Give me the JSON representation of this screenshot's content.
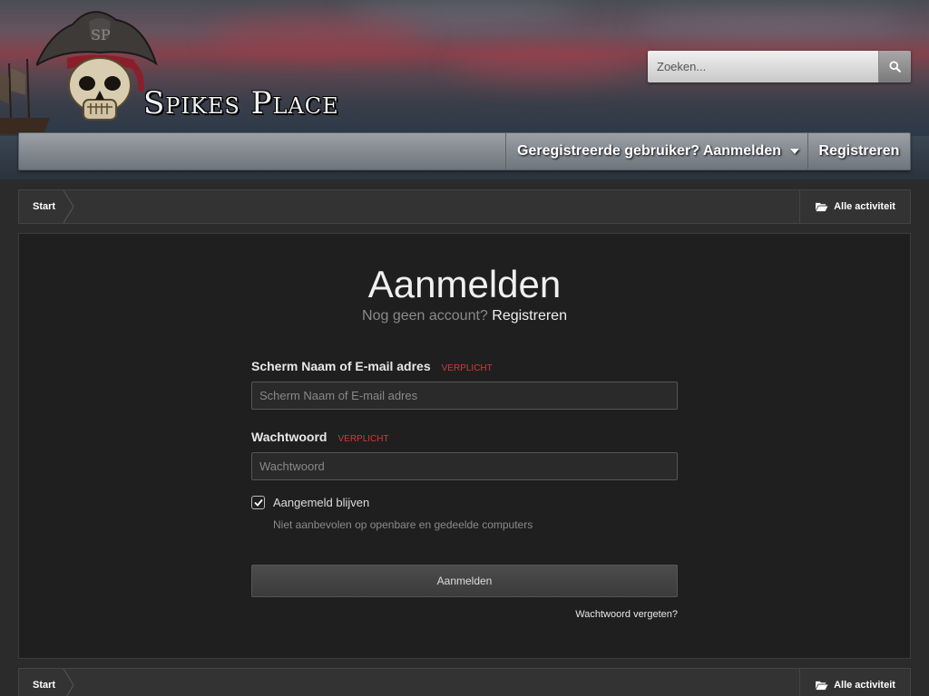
{
  "header": {
    "logo_text": "Spikes Place",
    "search": {
      "placeholder": "Zoeken..."
    }
  },
  "nav": {
    "user_menu_label": "Geregistreerde gebruiker? Aanmelden",
    "register_label": "Registreren"
  },
  "breadcrumb": {
    "start_label": "Start",
    "activity_label": "Alle activiteit"
  },
  "login": {
    "title": "Aanmelden",
    "no_account_text": "Nog geen account?",
    "register_link": "Registreren",
    "username": {
      "label": "Scherm Naam of E-mail adres",
      "required": "VERPLICHT",
      "placeholder": "Scherm Naam of E-mail adres",
      "value": ""
    },
    "password": {
      "label": "Wachtwoord",
      "required": "VERPLICHT",
      "placeholder": "Wachtwoord",
      "value": ""
    },
    "remember": {
      "label": "Aangemeld blijven",
      "description": "Niet aanbevolen op openbare en gedeelde computers",
      "checked": true
    },
    "submit_label": "Aanmelden",
    "forgot_label": "Wachtwoord vergeten?"
  },
  "colors": {
    "required": "#d23a3a",
    "panel_bg": "#1f1f1f",
    "page_bg": "#2b2b2b"
  }
}
